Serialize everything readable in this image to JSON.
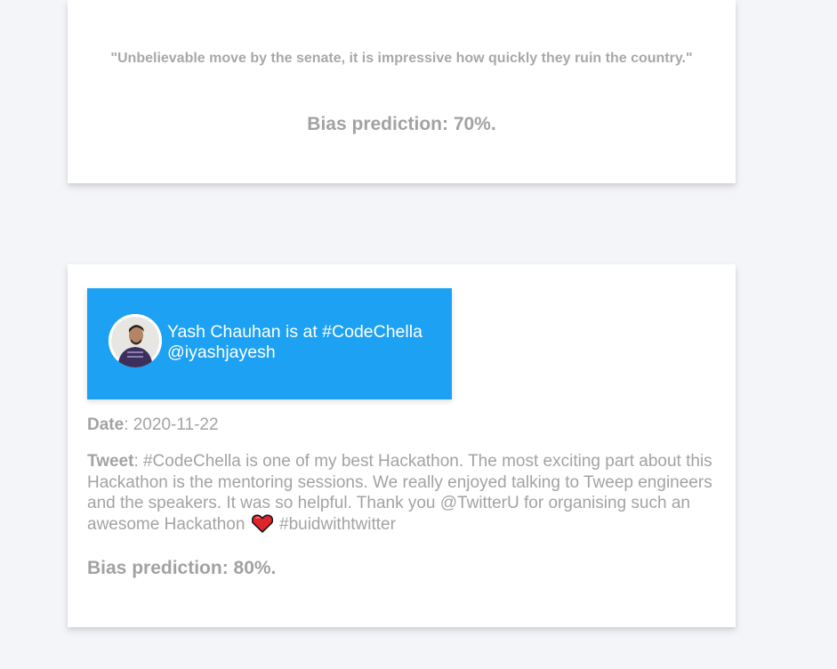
{
  "cards": [
    {
      "quote": "\"Unbelievable move by the senate, it is impressive how quickly they ruin the country.\"",
      "bias": "Bias prediction: 70%."
    },
    {
      "user_line": "Yash Chauhan is at #CodeChella",
      "handle": "@iyashjayesh",
      "date_label": "Date",
      "date_value": ": 2020-11-22",
      "tweet_label": "Tweet",
      "tweet_text_before_icon": ": #CodeChella is one of my best Hackathon. The most exciting part about this Hackathon is the mentoring sessions. We really enjoyed talking to Tweep engineers and the speakers. It was so helpful. Thank you @TwitterU for organising such an awesome Hackathon",
      "tweet_text_after_icon": " #buidwithtwitter",
      "inline_icon": "red-heart-icon",
      "bias": "Bias prediction: 80%."
    }
  ],
  "colors": {
    "page_background": "#f4f5f9",
    "card_background": "#ffffff",
    "twitter_blue": "#1da1f2",
    "muted_text": "#a3a3a3",
    "heart_red": "#e0242c"
  }
}
